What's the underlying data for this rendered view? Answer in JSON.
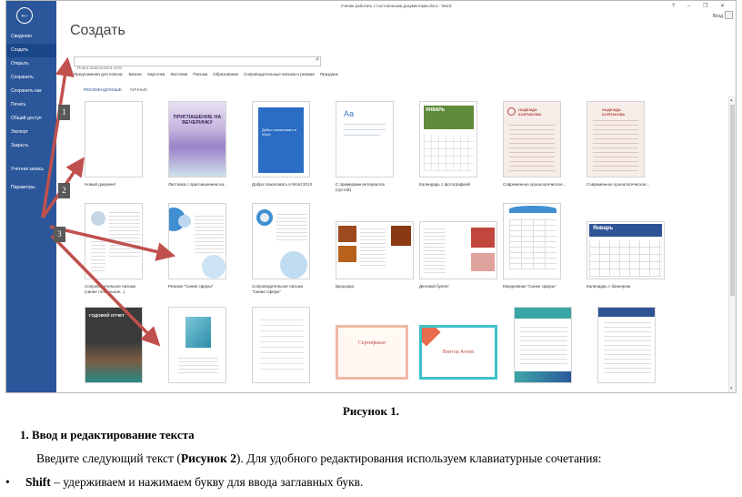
{
  "window": {
    "title": "Ученик работать с постоянными документами.docx - Word",
    "controls": "? – ❐ ✕",
    "sign_in": "Вход"
  },
  "sidebar": {
    "back": "←",
    "items": [
      {
        "label": "Сведения"
      },
      {
        "label": "Создать"
      },
      {
        "label": "Открыть"
      },
      {
        "label": "Сохранить"
      },
      {
        "label": "Сохранить как"
      },
      {
        "label": "Печать"
      },
      {
        "label": "Общий доступ"
      },
      {
        "label": "Экспорт"
      },
      {
        "label": "Закрыть"
      },
      {
        "label": "Учетная запись"
      },
      {
        "label": "Параметры"
      }
    ]
  },
  "main": {
    "title": "Создать",
    "search_placeholder": "Поиск шаблонов в сети",
    "categories": [
      "Предложения для поиска:",
      "Бизнес",
      "Карточки",
      "Листовки",
      "Письма",
      "Образование",
      "Сопроводительные письма и резюме",
      "Праздник"
    ],
    "tabs": [
      "РЕКОМЕНДУЕМЫЕ",
      "ЛИЧНЫЕ"
    ],
    "templates": [
      {
        "caption": "Новый документ"
      },
      {
        "caption": "Листовка с приглашением на...",
        "thumb_title": "ПРИГЛАШЕНИЕ НА ВЕЧЕРИНКУ"
      },
      {
        "caption": "Добро пожаловать в Word 2013",
        "thumb_title": "Добро пожаловать в Word"
      },
      {
        "caption": "С примерами интервалов (пустой)",
        "thumb_title": "Aa"
      },
      {
        "caption": "Календарь с фотографией",
        "thumb_title": "ЯНВАРЬ"
      },
      {
        "caption": "Современное хронологическое...",
        "thumb_title": "НАДЕЖДА КОЛПАКОВА"
      },
      {
        "caption": "Современное хронологическое...",
        "thumb_title": "НАДЕЖДА КОЛПАКОВА"
      },
      {
        "caption": "Сопроводительное письмо (синее глобальное...)"
      },
      {
        "caption": "Резюме \"Синие сферы\""
      },
      {
        "caption": "Сопроводительное письмо \"Синие сферы\""
      },
      {
        "caption": "Брошюра"
      },
      {
        "caption": "Деловой буклет"
      },
      {
        "caption": "Ежедневник \"Синие сферы\""
      },
      {
        "caption": "Календарь с баннером",
        "thumb_title": "Январь"
      },
      {
        "caption": "",
        "thumb_title": "ГОДОВОЙ ОТЧЕТ"
      },
      {
        "caption": ""
      },
      {
        "caption": ""
      },
      {
        "caption": "",
        "thumb_title": "Сертификат"
      },
      {
        "caption": "",
        "thumb_title": "Виктор Агеев"
      },
      {
        "caption": ""
      },
      {
        "caption": ""
      }
    ]
  },
  "annotations": [
    "1",
    "2",
    "3"
  ],
  "document": {
    "figure_caption": "Рисунок 1.",
    "heading": "1. Ввод и редактирование текста",
    "para_before": "Введите следующий текст (",
    "para_bold": "Рисунок 2",
    "para_after": "). Для удобного редактирования используем клавиатурные сочетания:",
    "bullet_bold": "Shift",
    "bullet_rest": " – удерживаем и нажимаем букву для ввода заглавных букв.",
    "bullet_mark": "•"
  },
  "colors": {
    "sidebar": "#2b579a",
    "arrow": "#c0504d",
    "tab_active": "#2b579a"
  }
}
